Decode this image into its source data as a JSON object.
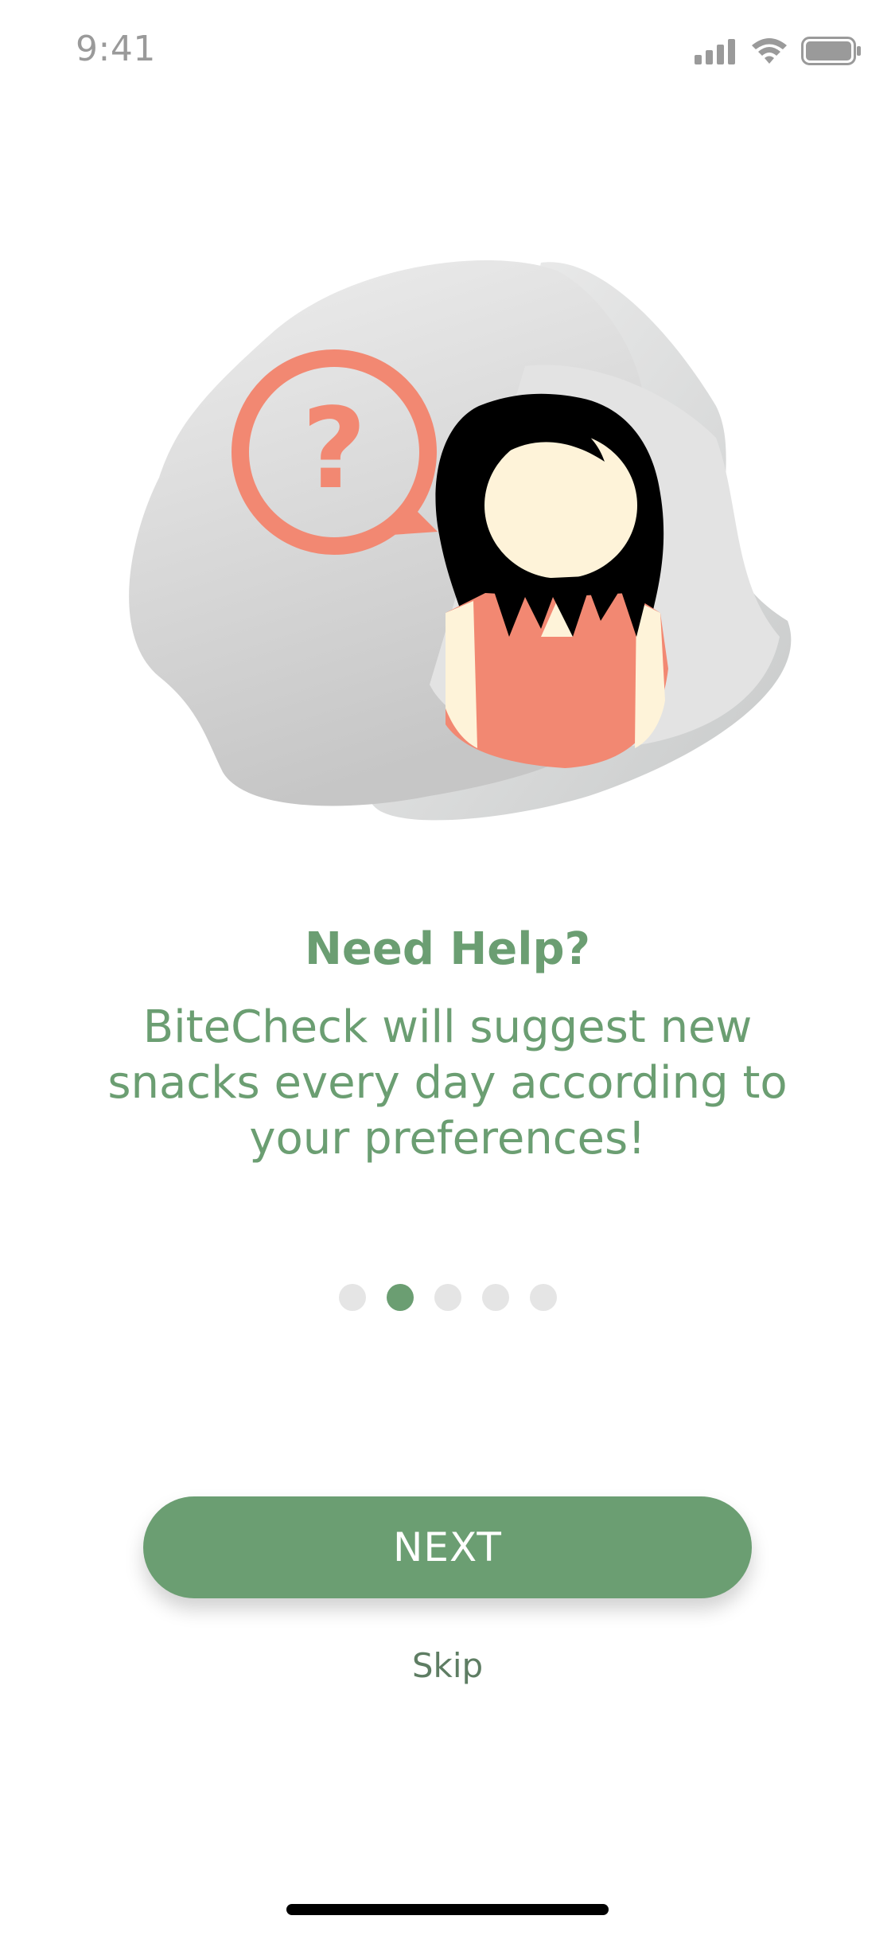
{
  "status_bar": {
    "time": "9:41",
    "icons": [
      "cellular-signal-icon",
      "wifi-icon",
      "battery-icon"
    ]
  },
  "illustration": {
    "subject": "question-speech-bubble-and-woman",
    "question_mark": "?"
  },
  "onboarding": {
    "title": "Need Help?",
    "description": "BiteCheck will suggest new snacks every day according to your preferences!",
    "pages_total": 5,
    "current_page": 2
  },
  "actions": {
    "next_label": "NEXT",
    "skip_label": "Skip"
  },
  "colors": {
    "brand_green": "#6b9e72",
    "accent_coral": "#f28872",
    "dot_inactive": "#e5e5e5"
  }
}
